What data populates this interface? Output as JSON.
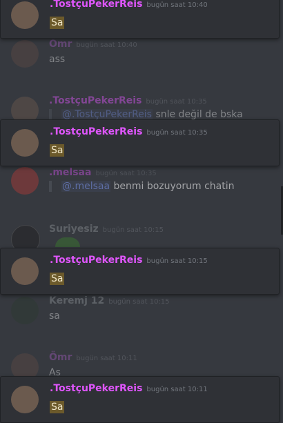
{
  "messages": [
    {
      "author": "Ömr",
      "time": "bugün saat 10:40",
      "text": "ass",
      "name_color": "#9b59b6"
    },
    {
      "author": ".TostçuPekerReis",
      "time": "bugün saat 10:35",
      "quote_mention": "@.TostçuPekerReis",
      "quote_text": "snle değil de bska",
      "name_color": "#e056fd"
    },
    {
      "author": ".melsaa",
      "time": "bugün saat 10:35",
      "quote_mention": "@.melsaa",
      "quote_text": "benmi bozuyorum chatin",
      "name_color": "#e056fd"
    },
    {
      "author": "Suriyesiz",
      "time": "bugün saat 10:15",
      "name_color": "#8e9297"
    },
    {
      "author": "Keremj 12",
      "time": "bugün saat 10:15",
      "text": "sa",
      "name_color": "#8e9297"
    },
    {
      "author": "Ömr",
      "time": "bugün saat 10:11",
      "text": "As",
      "name_color": "#9b59b6"
    }
  ],
  "overlays": [
    {
      "author": ".TostçuPekerReis",
      "time": "bugün saat 10:40",
      "text": "Sa"
    },
    {
      "author": ".TostçuPekerReis",
      "time": "bugün saat 10:35",
      "text": "Sa"
    },
    {
      "author": ".TostçuPekerReis",
      "time": "bugün saat 10:15",
      "text": "Sa"
    },
    {
      "author": ".TostçuPekerReis",
      "time": "bugün saat 10:11",
      "text": "Sa"
    }
  ]
}
